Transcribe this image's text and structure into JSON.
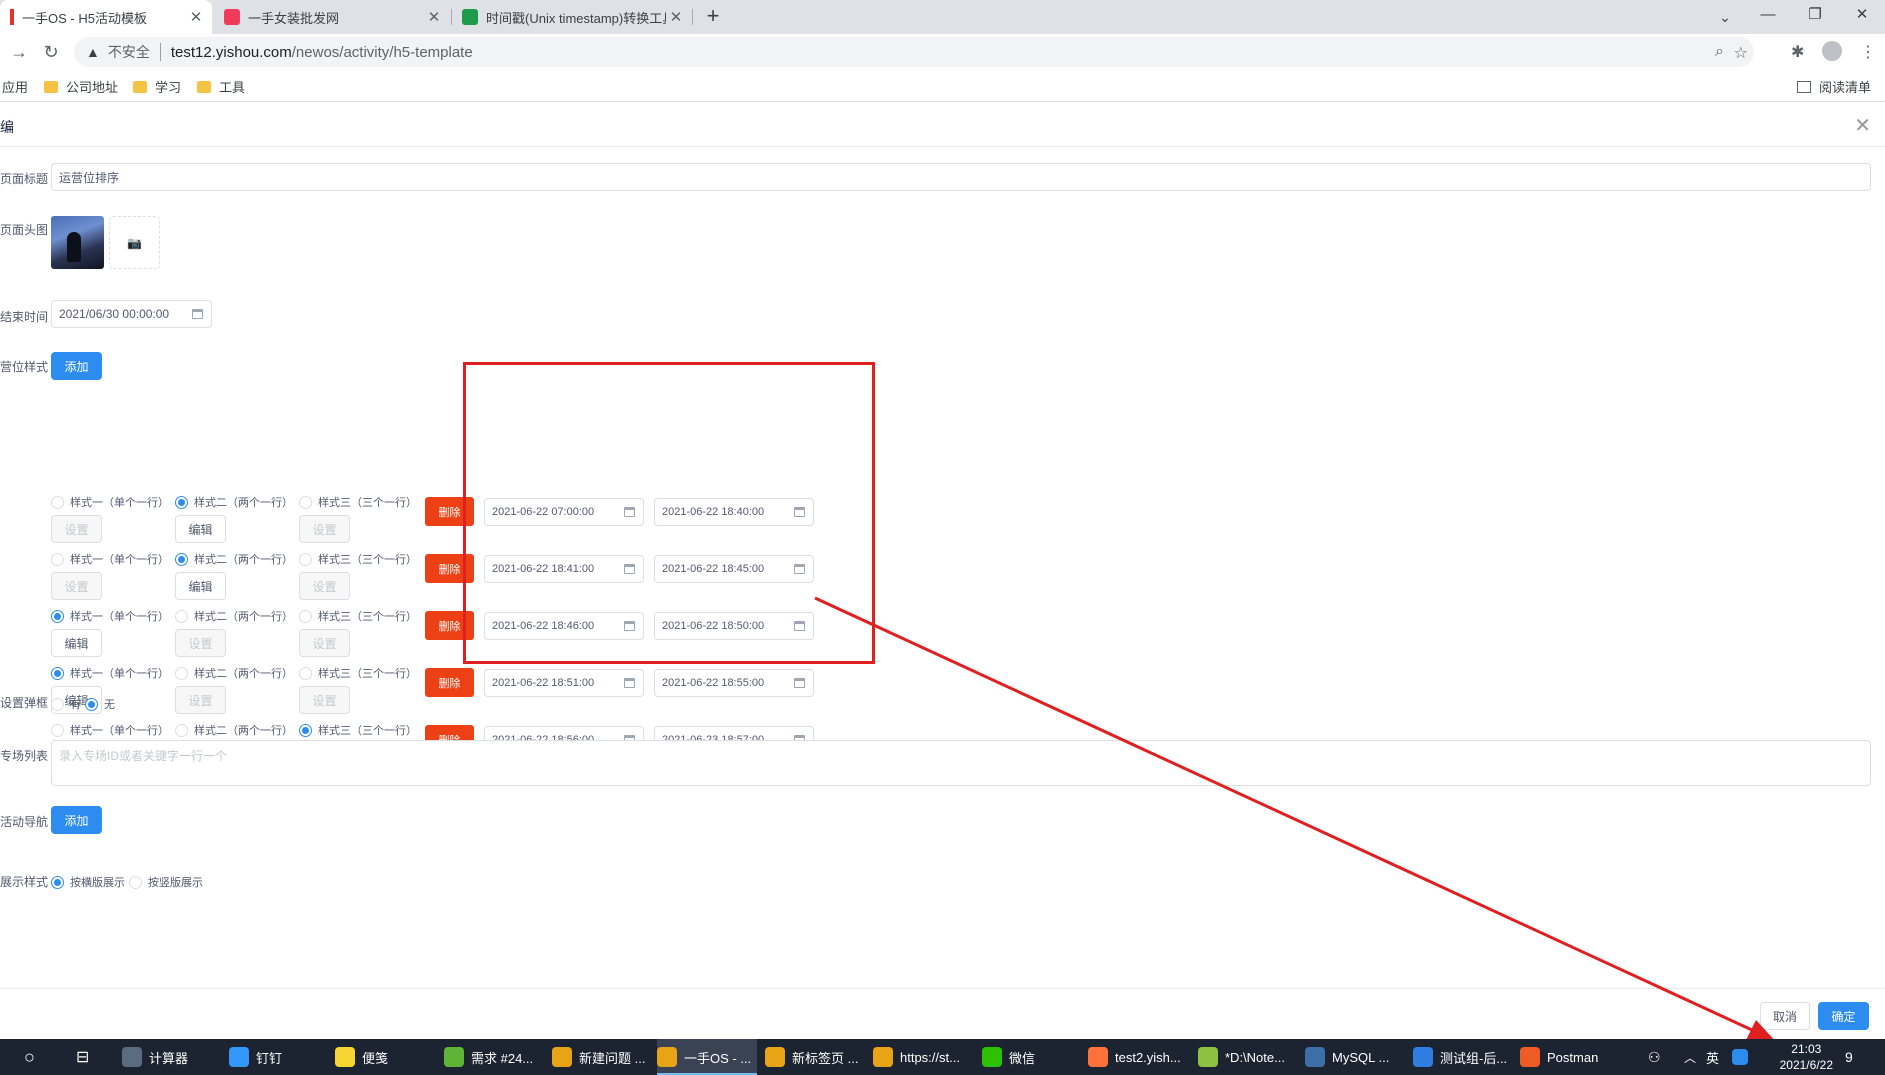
{
  "browser": {
    "tabs": [
      {
        "title": "一手OS - H5活动模板",
        "active": true,
        "favicon_color": "#e6312e"
      },
      {
        "title": "一手女装批发网",
        "active": false,
        "favicon_color": "#f03c5a"
      },
      {
        "title": "时间戳(Unix timestamp)转换工具",
        "active": false,
        "favicon_color": "#1e9b4a"
      }
    ],
    "insecure_label": "不安全",
    "url_host": "test12.yishou.com",
    "url_path": "/newos/activity/h5-template",
    "bookmarks": [
      {
        "label": "应用"
      },
      {
        "label": "公司地址"
      },
      {
        "label": "学习"
      },
      {
        "label": "工具"
      }
    ],
    "reading_list": "阅读清单"
  },
  "dialog": {
    "title": "编",
    "fields": {
      "page_title_label": "页面标题",
      "page_title_value": "运营位排序",
      "page_image_label": "页面头图",
      "end_time_label": "结束时间",
      "end_time_value": "2021/06/30 00:00:00",
      "ops_style_label": "营位样式",
      "add_label": "添加",
      "popup_label": "设置弹框",
      "popup_yes": "有",
      "popup_no": "无",
      "venue_label": "专场列表",
      "venue_placeholder": "录入专场ID或者关键字一行一个",
      "nav_label": "活动导航",
      "display_label": "展示样式",
      "display_horizontal": "按横版展示",
      "display_vertical": "按竖版展示"
    },
    "style_options": [
      "样式一（单个一行）",
      "样式二（两个一行）",
      "样式三（三个一行）"
    ],
    "setting_label": "设置",
    "edit_label": "编辑",
    "delete_label": "删除",
    "rows": [
      {
        "selected": 2,
        "start": "2021-06-22 07:00:00",
        "end": "2021-06-22 18:40:00"
      },
      {
        "selected": 2,
        "start": "2021-06-22 18:41:00",
        "end": "2021-06-22 18:45:00"
      },
      {
        "selected": 1,
        "start": "2021-06-22 18:46:00",
        "end": "2021-06-22 18:50:00"
      },
      {
        "selected": 1,
        "start": "2021-06-22 18:51:00",
        "end": "2021-06-22 18:55:00"
      },
      {
        "selected": 3,
        "start": "2021-06-22 18:56:00",
        "end": "2021-06-23 18:57:00"
      }
    ],
    "cancel_label": "取消",
    "ok_label": "确定"
  },
  "annotation_color": "#e02020",
  "taskbar": {
    "items": [
      {
        "label": "计算器",
        "color": "#5a6b82"
      },
      {
        "label": "钉钉",
        "color": "#3296fa"
      },
      {
        "label": "便笺",
        "color": "#f7d533"
      },
      {
        "label": "需求 #24...",
        "color": "#5fb336"
      },
      {
        "label": "新建问题 ...",
        "color": "#e8a317"
      },
      {
        "label": "一手OS - ...",
        "color": "#e8a317"
      },
      {
        "label": "新标签页 ...",
        "color": "#e8a317"
      },
      {
        "label": "https://st...",
        "color": "#e8a317"
      },
      {
        "label": "微信",
        "color": "#2dc100"
      },
      {
        "label": "test2.yish...",
        "color": "#ff7139"
      },
      {
        "label": "*D:\\Note...",
        "color": "#90c040"
      },
      {
        "label": "MySQL ...",
        "color": "#3d6ea8"
      },
      {
        "label": "测试组-后...",
        "color": "#2f7de1"
      },
      {
        "label": "Postman",
        "color": "#ef5b25"
      }
    ],
    "ime": "英",
    "time": "21:03",
    "date": "2021/6/22",
    "notifications": "9"
  }
}
